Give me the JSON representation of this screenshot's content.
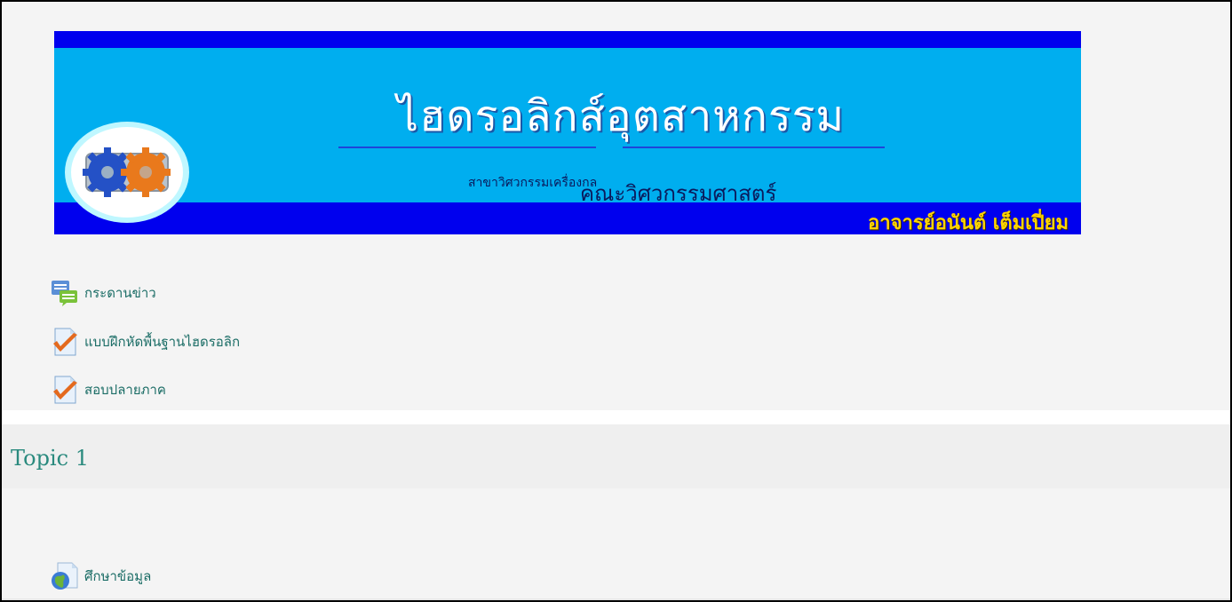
{
  "banner": {
    "title": "ไฮดรอลิกส์อุตสาหกรรม",
    "department": "สาขาวิศวกรรมเครื่องกล",
    "faculty": "คณะวิศวกรรมศาสตร์",
    "teacher": "อาจารย์อนันต์  เต็มเปี่ยม",
    "colors": {
      "bg": "#00aeef",
      "strip": "#0000ee",
      "teacher": "#ffd400"
    }
  },
  "activities": [
    {
      "label": "กระดานข่าว",
      "icon": "forum-icon"
    },
    {
      "label": "แบบฝึกหัดพื้นฐานไฮดรอลิก",
      "icon": "quiz-icon"
    },
    {
      "label": "สอบปลายภาค",
      "icon": "quiz-icon"
    }
  ],
  "topic1": {
    "title": "Topic 1",
    "activities": [
      {
        "label": "ศึกษาข้อมูล",
        "icon": "url-icon"
      }
    ]
  }
}
